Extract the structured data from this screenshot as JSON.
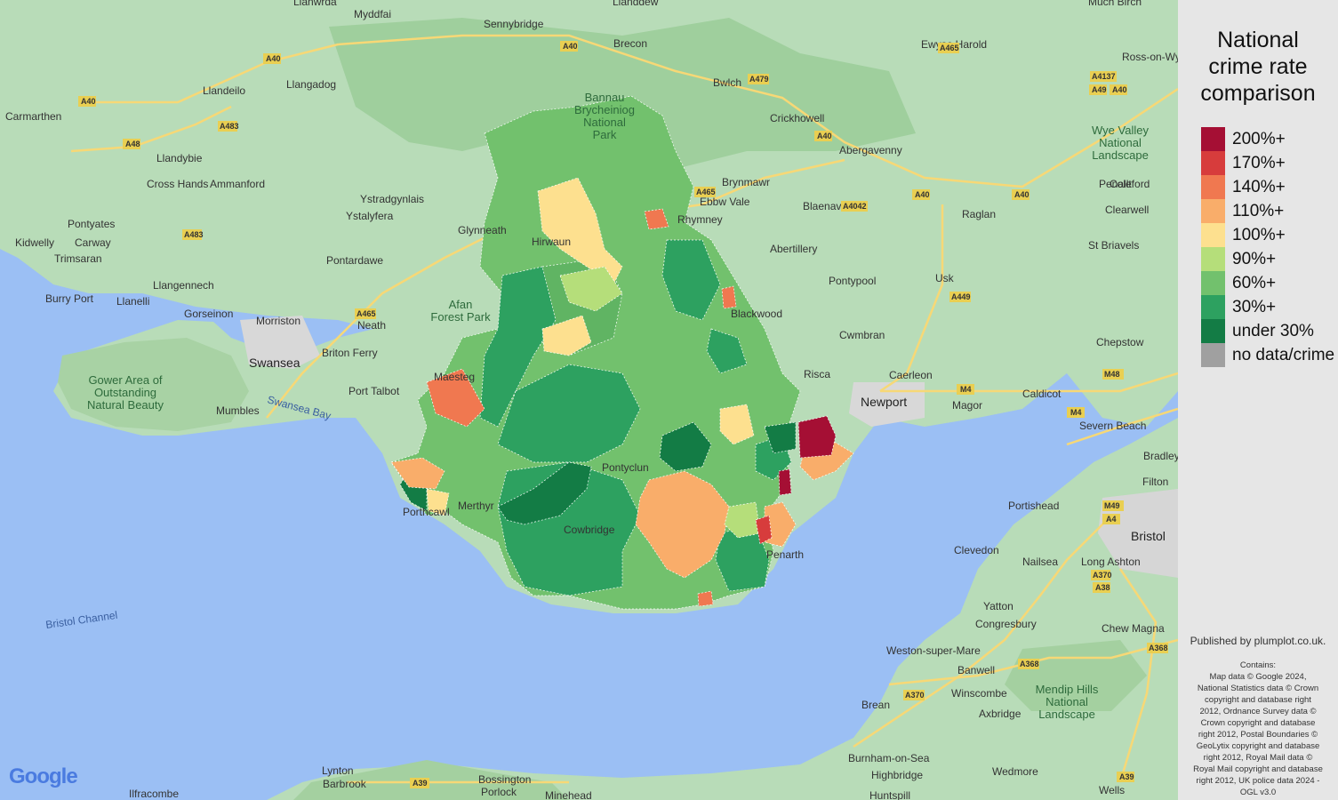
{
  "legend": {
    "title_lines": [
      "National",
      "crime rate",
      "comparison"
    ],
    "items": [
      {
        "label": "200%+",
        "color": "#a50f34"
      },
      {
        "label": "170%+",
        "color": "#d73c3c"
      },
      {
        "label": "140%+",
        "color": "#f07850"
      },
      {
        "label": "110%+",
        "color": "#f9ad6a"
      },
      {
        "label": "100%+",
        "color": "#fde08f"
      },
      {
        "label": "90%+",
        "color": "#b5de7a"
      },
      {
        "label": "60%+",
        "color": "#72c16d"
      },
      {
        "label": "30%+",
        "color": "#2da160"
      },
      {
        "label": "under 30%",
        "color": "#137c45"
      },
      {
        "label": "no data/crime",
        "color": "#a0a0a0"
      }
    ]
  },
  "published": "Published by plumplot.co.uk.",
  "contains": [
    "Contains:",
    "Map data © Google 2024,",
    "National Statistics data © Crown",
    "copyright and database right",
    "2012, Ordnance Survey data ©",
    "Crown copyright and database",
    "right 2012, Postal Boundaries ©",
    "GeoLytix copyright and database",
    "right 2012, Royal Mail data ©",
    "Royal Mail copyright and database",
    "right 2012, UK police data 2024 -",
    "OGL v3.0"
  ],
  "google_logo": "Google",
  "places": [
    "Llanwrda",
    "Myddfai",
    "Sennybridge",
    "Llanddew",
    "Brecon",
    "Ewyas Harold",
    "Much Birch",
    "Llangadog",
    "Llandeilo",
    "Bwlch",
    "Crickhowell",
    "Ross-on-Wye",
    "Carmarthen",
    "Llandybie",
    "Abergavenny",
    "Cross Hands",
    "Ammanford",
    "Brynmawr",
    "Ebbw Vale",
    "Blaenavon",
    "Penallt",
    "Coleford",
    "Ystradgynlais",
    "Ystalyfera",
    "Raglan",
    "Clearwell",
    "Pontyates",
    "Carway",
    "Glynneath",
    "Hirwaun",
    "Rhymney",
    "Abertillery",
    "Kidwelly",
    "Trimsaran",
    "Pontardawe",
    "St Briavels",
    "Pontypool",
    "Usk",
    "Llangennech",
    "Burry Port",
    "Llanelli",
    "Gorseinon",
    "Morriston",
    "Neath",
    "Blackwood",
    "Cwmbran",
    "Chepstow",
    "Swansea",
    "Briton Ferry",
    "Risca",
    "Caerleon",
    "Port Talbot",
    "Caldicot",
    "Mumbles",
    "Newport",
    "Magor",
    "Maesteg",
    "Severn Beach",
    "Bradley",
    "Filton",
    "Portishead",
    "Porthcawl",
    "Cowbridge",
    "Bristol",
    "Clevedon",
    "Nailsea",
    "Long Ashton",
    "Penarth",
    "Yatton",
    "Congresbury",
    "Chew Magna",
    "Weston-super-Mare",
    "Banwell",
    "Winscombe",
    "Axbridge",
    "Brean",
    "Burnham-on-Sea",
    "Wedmore",
    "Highbridge",
    "Lynton",
    "Barbrook",
    "Bossington",
    "Porlock",
    "Minehead",
    "Ilfracombe",
    "Huntspill",
    "Wells",
    "Merthyr",
    "Pontyclun"
  ],
  "water_labels": [
    "Swansea Bay",
    "Bristol Channel"
  ],
  "park_labels": [
    [
      "Gower Area of",
      "Outstanding",
      "Natural Beauty"
    ],
    [
      "Afan",
      "Forest Park"
    ],
    [
      "Bannau",
      "Brycheiniog",
      "National",
      "Park"
    ],
    [
      "Wye Valley",
      "National",
      "Landscape"
    ],
    [
      "Mendip Hills",
      "National",
      "Landscape"
    ]
  ],
  "roads": [
    "A40",
    "A40",
    "A40",
    "A483",
    "A48",
    "A483",
    "A465",
    "A479",
    "A40",
    "A465",
    "A4042",
    "A40",
    "A40",
    "A449",
    "A465",
    "A4137",
    "A49",
    "A40",
    "M4",
    "M4",
    "M48",
    "M49",
    "A4",
    "A370",
    "A38",
    "A368",
    "A370",
    "A368",
    "A39",
    "A39"
  ]
}
